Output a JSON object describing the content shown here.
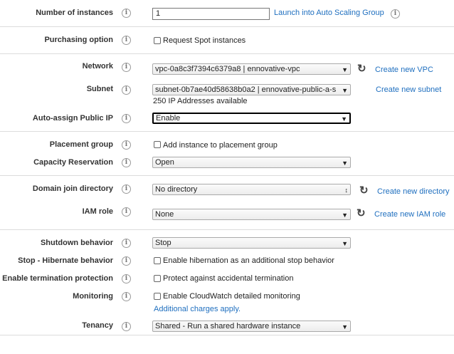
{
  "fields": {
    "number_of_instances": {
      "label": "Number of instances",
      "value": "1",
      "link": "Launch into Auto Scaling Group"
    },
    "purchasing_option": {
      "label": "Purchasing option",
      "checkbox": "Request Spot instances"
    },
    "network": {
      "label": "Network",
      "value": "vpc-0a8c3f7394c6379a8 | ennovative-vpc",
      "link": "Create new VPC"
    },
    "subnet": {
      "label": "Subnet",
      "value": "subnet-0b7ae40d58638b0a2 | ennovative-public-a-s",
      "note": "250 IP Addresses available",
      "link": "Create new subnet"
    },
    "auto_assign_ip": {
      "label": "Auto-assign Public IP",
      "value": "Enable"
    },
    "placement_group": {
      "label": "Placement group",
      "checkbox": "Add instance to placement group"
    },
    "capacity_reservation": {
      "label": "Capacity Reservation",
      "value": "Open"
    },
    "domain_join": {
      "label": "Domain join directory",
      "value": "No directory",
      "link": "Create new directory"
    },
    "iam_role": {
      "label": "IAM role",
      "value": "None",
      "link": "Create new IAM role"
    },
    "shutdown_behavior": {
      "label": "Shutdown behavior",
      "value": "Stop"
    },
    "stop_hibernate": {
      "label": "Stop - Hibernate behavior",
      "checkbox": "Enable hibernation as an additional stop behavior"
    },
    "termination_protection": {
      "label": "Enable termination protection",
      "checkbox": "Protect against accidental termination"
    },
    "monitoring": {
      "label": "Monitoring",
      "checkbox": "Enable CloudWatch detailed monitoring",
      "link": "Additional charges apply."
    },
    "tenancy": {
      "label": "Tenancy",
      "value": "Shared - Run a shared hardware instance"
    }
  },
  "icons": {
    "info": "info-icon",
    "refresh": "refresh-icon",
    "dropdown": "dropdown-arrow-icon"
  },
  "colors": {
    "link": "#1f6fbf",
    "divider": "#dcdcdc"
  }
}
